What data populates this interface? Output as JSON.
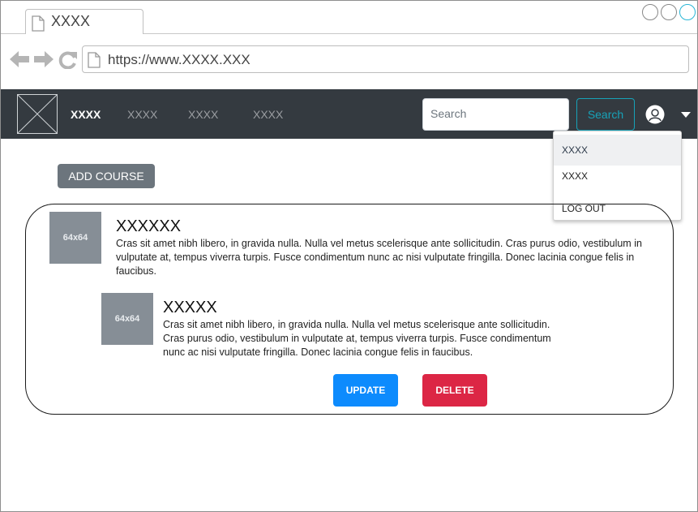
{
  "browser": {
    "tab_title": "XXXX",
    "url": "https://www.XXXX.XXX"
  },
  "navbar": {
    "links": [
      "XXXX",
      "XXXX",
      "XXXX",
      "XXXX"
    ],
    "search_placeholder": "Search",
    "search_button": "Search"
  },
  "user_menu": {
    "items": [
      "XXXX",
      "XXXX",
      "LOG OUT"
    ]
  },
  "main": {
    "add_course_label": "ADD COURSE",
    "course": {
      "thumb_label": "64x64",
      "title": "XXXXXX",
      "body": "Cras sit amet nibh libero, in gravida nulla. Nulla vel metus scelerisque ante sollicitudin. Cras purus odio, vestibulum in vulputate at, tempus viverra turpis. Fusce condimentum nunc ac nisi vulputate fringilla. Donec lacinia congue felis in faucibus.",
      "nested": {
        "thumb_label": "64x64",
        "title": "XXXXX",
        "body": "Cras sit amet nibh libero, in gravida nulla. Nulla vel metus scelerisque ante sollicitudin. Cras purus odio, vestibulum in vulputate at, tempus viverra turpis. Fusce condimentum nunc ac nisi vulputate fringilla. Donec lacinia congue felis in faucibus."
      },
      "update_label": "UPDATE",
      "delete_label": "DELETE"
    }
  },
  "colors": {
    "navbar_bg": "#343a40",
    "search_btn": "#17a2b8",
    "update_btn": "#0d8bfd",
    "delete_btn": "#dc2645",
    "add_btn": "#6c757d"
  },
  "icons": [
    "page-icon",
    "back-arrow-icon",
    "forward-arrow-icon",
    "reload-icon",
    "logo-placeholder-icon",
    "user-icon",
    "caret-down-icon"
  ]
}
